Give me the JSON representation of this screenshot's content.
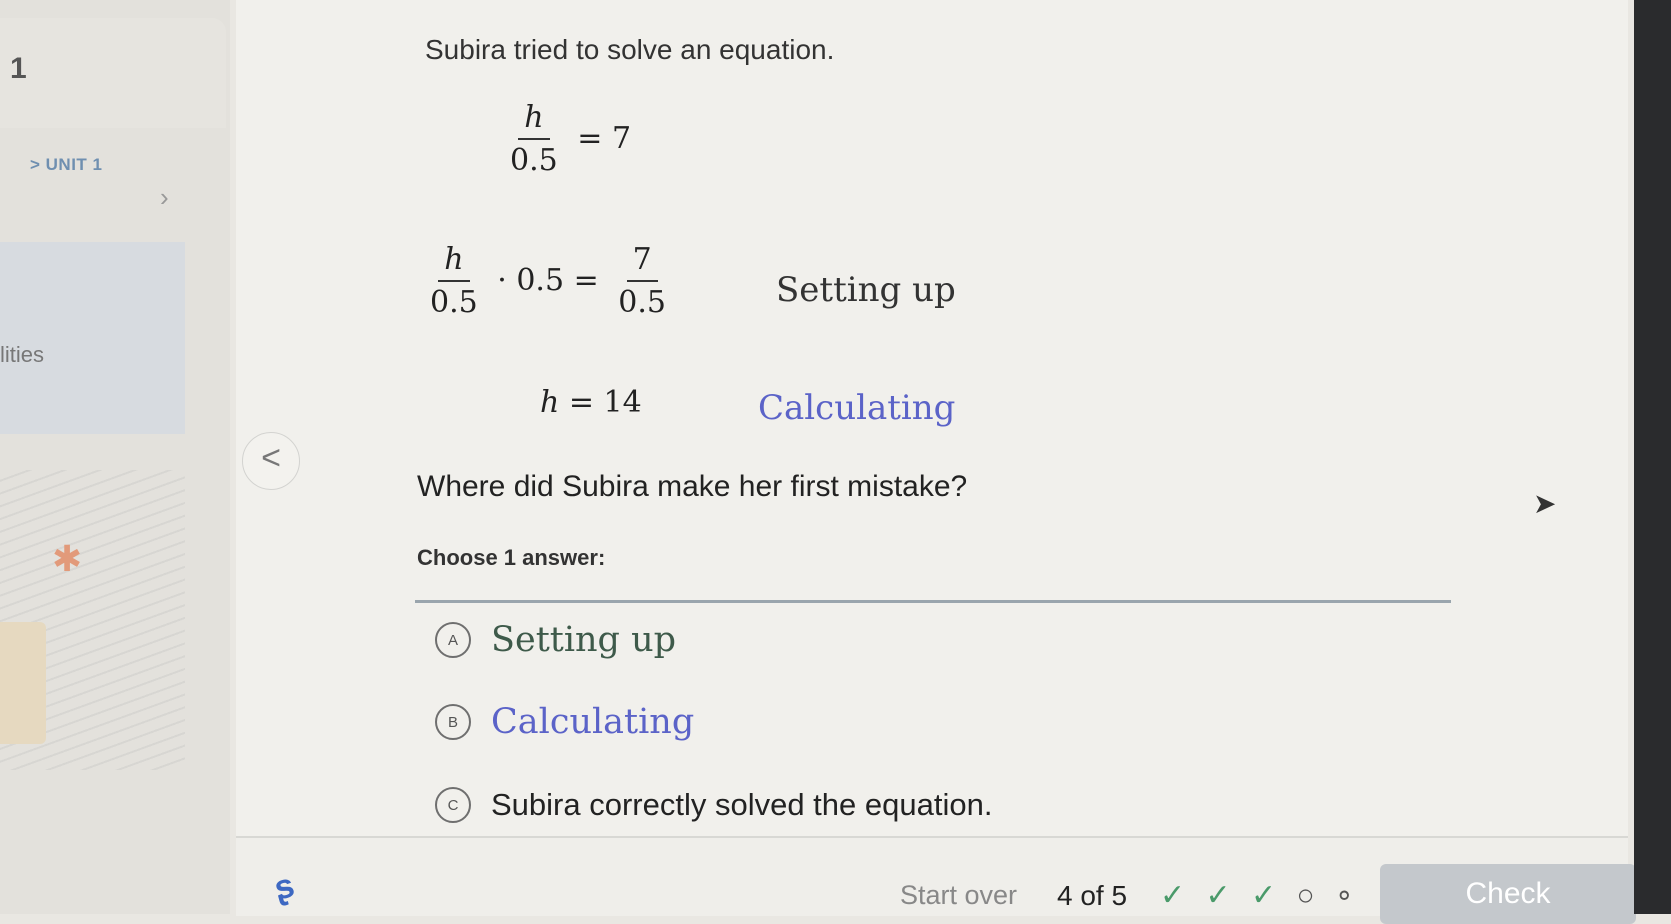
{
  "sidebar": {
    "number": "1",
    "unit_label": "> UNIT 1",
    "chevron": "›",
    "active_item_text": "lities"
  },
  "nav": {
    "prev_arrow": "<"
  },
  "question": {
    "intro": "Subira tried to solve an equation.",
    "step1": {
      "num": "h",
      "den": "0.5",
      "rhs": "= 7"
    },
    "step2": {
      "num": "h",
      "den": "0.5",
      "mult": "· 0.5 =",
      "rhs_num": "7",
      "rhs_den": "0.5",
      "label": "Setting up"
    },
    "step3": {
      "lhs": "h",
      "rhs": "= 14",
      "label": "Calculating"
    },
    "ask": "Where did Subira make her first mistake?",
    "choose": "Choose 1 answer:"
  },
  "choices": [
    {
      "letter": "A",
      "text": "Setting up"
    },
    {
      "letter": "B",
      "text": "Calculating"
    },
    {
      "letter": "C",
      "text": "Subira correctly solved the equation."
    }
  ],
  "footer": {
    "start_over": "Start over",
    "progress": "4 of 5",
    "done_marks": "✓ ✓ ✓",
    "current_mark": "○",
    "next_mark": "∘",
    "check": "Check"
  },
  "colors": {
    "accent_blue": "#5b63c8",
    "check_button": "#c4c8cc",
    "progress_green": "#4a9a6a"
  }
}
